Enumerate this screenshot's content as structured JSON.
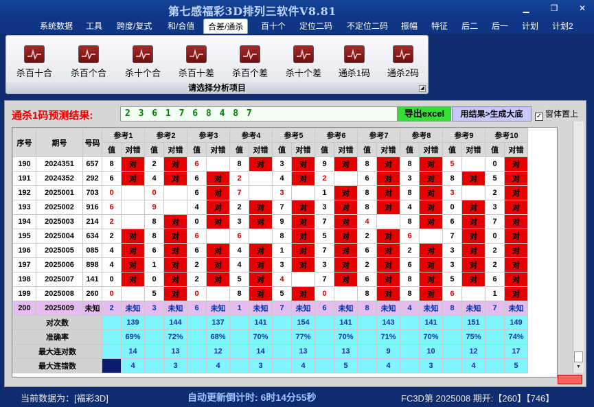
{
  "app": {
    "title": "第七感福彩3D排列三软件V8.81"
  },
  "menu": [
    "系统数据",
    "工具",
    "跨度/复式",
    "和/合值",
    "合差/通杀",
    "百十个",
    "定位二码",
    "不定位二码",
    "振幅",
    "特征",
    "后二",
    "后一",
    "计划",
    "计划2"
  ],
  "menu_active": "合差/通杀",
  "ribbon": {
    "buttons": [
      "杀百十合",
      "杀百个合",
      "杀十个合",
      "杀百十差",
      "杀百个差",
      "杀十个差",
      "通杀1码",
      "通杀2码"
    ],
    "footer": "请选择分析项目"
  },
  "prediction": {
    "label": "通杀1码预测结果:",
    "numbers": "2 3 6 1 7 6 8 4 8 7",
    "export_label": "导出excel",
    "result_label": "用结果>生成大底",
    "topmost_label": "窗体置上",
    "topmost_checked": true
  },
  "table": {
    "h_seq": "序号",
    "h_period": "期号",
    "h_code": "号码",
    "refs": [
      "参考1",
      "参考2",
      "参考3",
      "参考4",
      "参考5",
      "参考6",
      "参考7",
      "参考8",
      "参考9",
      "参考10"
    ],
    "sub": [
      "值",
      "对错"
    ],
    "hit_text": "对",
    "rows": [
      {
        "seq": "190",
        "period": "2024351",
        "code": "657",
        "vals": [
          "8",
          "2",
          "6",
          "8",
          "3",
          "9",
          "8",
          "8",
          "5",
          "0"
        ],
        "hit": [
          1,
          1,
          0,
          1,
          1,
          1,
          1,
          1,
          0,
          1
        ],
        "red": [
          0,
          0,
          1,
          0,
          0,
          0,
          0,
          0,
          1,
          0
        ]
      },
      {
        "seq": "191",
        "period": "2024352",
        "code": "292",
        "vals": [
          "6",
          "4",
          "6",
          "2",
          "4",
          "2",
          "6",
          "3",
          "8",
          "5"
        ],
        "hit": [
          1,
          1,
          1,
          0,
          1,
          0,
          1,
          1,
          1,
          1
        ],
        "red": [
          0,
          0,
          0,
          1,
          0,
          1,
          0,
          0,
          0,
          0
        ]
      },
      {
        "seq": "192",
        "period": "2025001",
        "code": "703",
        "vals": [
          "0",
          "0",
          "6",
          "7",
          "3",
          "1",
          "8",
          "8",
          "3",
          "2"
        ],
        "hit": [
          0,
          0,
          1,
          0,
          0,
          1,
          1,
          1,
          0,
          1
        ],
        "red": [
          1,
          1,
          0,
          1,
          1,
          0,
          0,
          0,
          1,
          0
        ]
      },
      {
        "seq": "193",
        "period": "2025002",
        "code": "916",
        "vals": [
          "6",
          "9",
          "4",
          "2",
          "7",
          "3",
          "8",
          "4",
          "0",
          "3"
        ],
        "hit": [
          0,
          0,
          1,
          1,
          1,
          1,
          1,
          1,
          1,
          1
        ],
        "red": [
          1,
          1,
          0,
          0,
          0,
          0,
          0,
          0,
          0,
          0
        ]
      },
      {
        "seq": "194",
        "period": "2025003",
        "code": "214",
        "vals": [
          "2",
          "8",
          "0",
          "3",
          "9",
          "7",
          "4",
          "8",
          "6",
          "7"
        ],
        "hit": [
          0,
          1,
          1,
          1,
          1,
          1,
          0,
          1,
          1,
          1
        ],
        "red": [
          1,
          0,
          0,
          0,
          0,
          0,
          1,
          0,
          0,
          0
        ]
      },
      {
        "seq": "195",
        "period": "2025004",
        "code": "634",
        "vals": [
          "2",
          "8",
          "6",
          "6",
          "8",
          "5",
          "2",
          "6",
          "7",
          "0"
        ],
        "hit": [
          1,
          1,
          0,
          0,
          1,
          1,
          1,
          0,
          1,
          1
        ],
        "red": [
          0,
          0,
          1,
          1,
          0,
          0,
          0,
          1,
          0,
          0
        ]
      },
      {
        "seq": "196",
        "period": "2025005",
        "code": "085",
        "vals": [
          "4",
          "6",
          "6",
          "4",
          "1",
          "7",
          "6",
          "2",
          "3",
          "2"
        ],
        "hit": [
          1,
          1,
          1,
          1,
          1,
          1,
          1,
          1,
          1,
          1
        ],
        "red": [
          0,
          0,
          0,
          0,
          0,
          0,
          0,
          0,
          0,
          0
        ]
      },
      {
        "seq": "197",
        "period": "2025006",
        "code": "898",
        "vals": [
          "4",
          "1",
          "2",
          "4",
          "3",
          "3",
          "2",
          "6",
          "3",
          "2"
        ],
        "hit": [
          1,
          1,
          1,
          1,
          1,
          1,
          1,
          1,
          1,
          1
        ],
        "red": [
          0,
          0,
          0,
          0,
          0,
          0,
          0,
          0,
          0,
          0
        ]
      },
      {
        "seq": "198",
        "period": "2025007",
        "code": "141",
        "vals": [
          "0",
          "0",
          "2",
          "5",
          "4",
          "7",
          "6",
          "8",
          "5",
          "6"
        ],
        "hit": [
          1,
          1,
          1,
          1,
          0,
          1,
          1,
          1,
          1,
          1
        ],
        "red": [
          0,
          0,
          0,
          0,
          1,
          0,
          0,
          0,
          0,
          0
        ]
      },
      {
        "seq": "199",
        "period": "2025008",
        "code": "260",
        "vals": [
          "0",
          "5",
          "0",
          "8",
          "5",
          "0",
          "8",
          "8",
          "6",
          "1"
        ],
        "hit": [
          0,
          1,
          0,
          1,
          1,
          0,
          1,
          1,
          0,
          1
        ],
        "red": [
          1,
          0,
          1,
          0,
          0,
          1,
          0,
          0,
          1,
          0
        ]
      }
    ],
    "pending": {
      "seq": "200",
      "period": "2025009",
      "code": "未知",
      "vals": [
        "2",
        "3",
        "6",
        "1",
        "7",
        "6",
        "8",
        "4",
        "8",
        "7"
      ],
      "status": "未知"
    },
    "stats": [
      {
        "label": "对次数",
        "vals": [
          "139",
          "144",
          "137",
          "141",
          "154",
          "141",
          "143",
          "141",
          "151",
          "149"
        ]
      },
      {
        "label": "准确率",
        "vals": [
          "69%",
          "72%",
          "68%",
          "70%",
          "77%",
          "70%",
          "71%",
          "70%",
          "75%",
          "74%"
        ]
      },
      {
        "label": "最大连对数",
        "vals": [
          "14",
          "13",
          "12",
          "14",
          "13",
          "13",
          "9",
          "10",
          "12",
          "17"
        ]
      },
      {
        "label": "最大连错数",
        "vals": [
          "4",
          "3",
          "4",
          "3",
          "4",
          "5",
          "4",
          "3",
          "4",
          "5"
        ]
      }
    ]
  },
  "status": {
    "current": "当前数据为：[福彩3D]",
    "countdown": "自动更新倒计时:  6时14分55秒",
    "draw": "FC3D第 2025008 期开:【260】【746】"
  },
  "colors": {
    "hit": "#e60000",
    "stats_bg": "#7ff5ff",
    "pending_bg": "#e4bcf0",
    "title_bg": "#0e2c6e"
  }
}
